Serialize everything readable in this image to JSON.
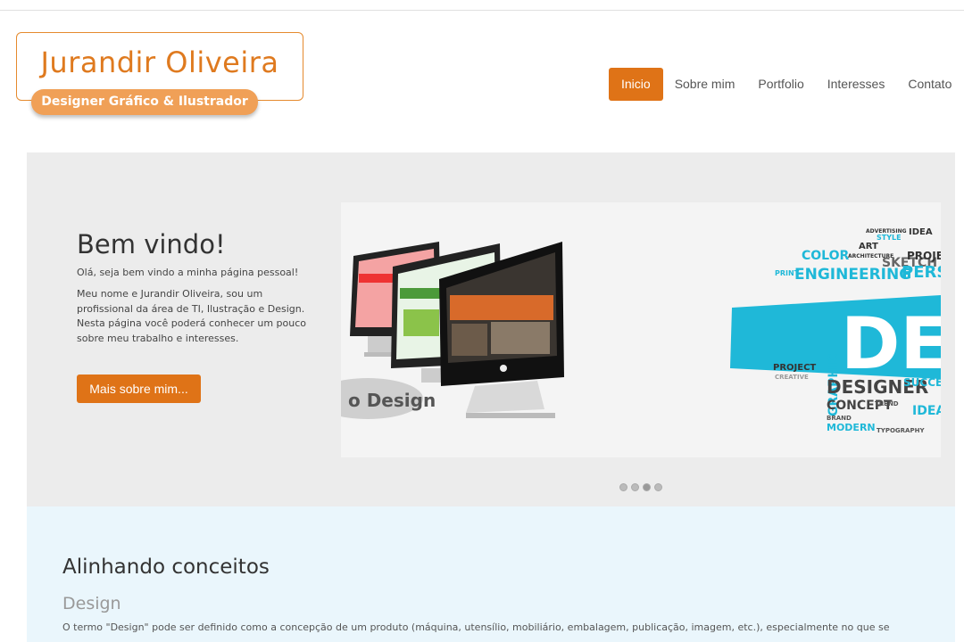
{
  "logo": {
    "name": "Jurandir Oliveira",
    "tagline": "Designer Gráfico & Ilustrador"
  },
  "nav": {
    "items": [
      {
        "label": "Inicio",
        "active": true
      },
      {
        "label": "Sobre mim",
        "active": false
      },
      {
        "label": "Portfolio",
        "active": false
      },
      {
        "label": "Interesses",
        "active": false
      },
      {
        "label": "Contato",
        "active": false
      }
    ]
  },
  "hero": {
    "title": "Bem vindo!",
    "subtitle": "Olá, seja bem vindo a minha página pessoal!",
    "text": "Meu nome e Jurandir Oliveira, sou um profissional da área de TI, Ilustração e Design. Nesta página você poderá conhecer um pouco sobre meu trabalho e interesses.",
    "button": "Mais sobre mim...",
    "slide": {
      "banner_text": "o Design",
      "word_cloud": [
        "COLOR",
        "ARCHITECTURE",
        "ART",
        "STYLE",
        "ADVERTISING",
        "SKETCH",
        "IDEA",
        "PROJECT",
        "PERSP",
        "PRINT",
        "ENGINEERING",
        "DES",
        "PROJECT",
        "CREATIVE",
        "GRAPHIC",
        "DESIGNER",
        "SUCCESS",
        "CONCEPT",
        "TREND",
        "IDEA",
        "BRAND",
        "MODERN",
        "TYPOGRAPHY"
      ]
    },
    "dots": {
      "count": 4,
      "active": 2
    }
  },
  "section": {
    "title": "Alinhando conceitos",
    "subtitle": "Design",
    "text": "O termo \"Design\" pode ser definido como a concepção de um produto (máquina, utensílio, mobiliário, embalagem, publicação, imagem, etc.), especialmente no que se"
  },
  "colors": {
    "accent": "#df7317",
    "logo_orange": "#df7a1f",
    "tag_orange": "#f0a057",
    "hero_bg": "#ececec",
    "section_bg": "#eaf6fc",
    "cyan": "#1fb8d8"
  }
}
